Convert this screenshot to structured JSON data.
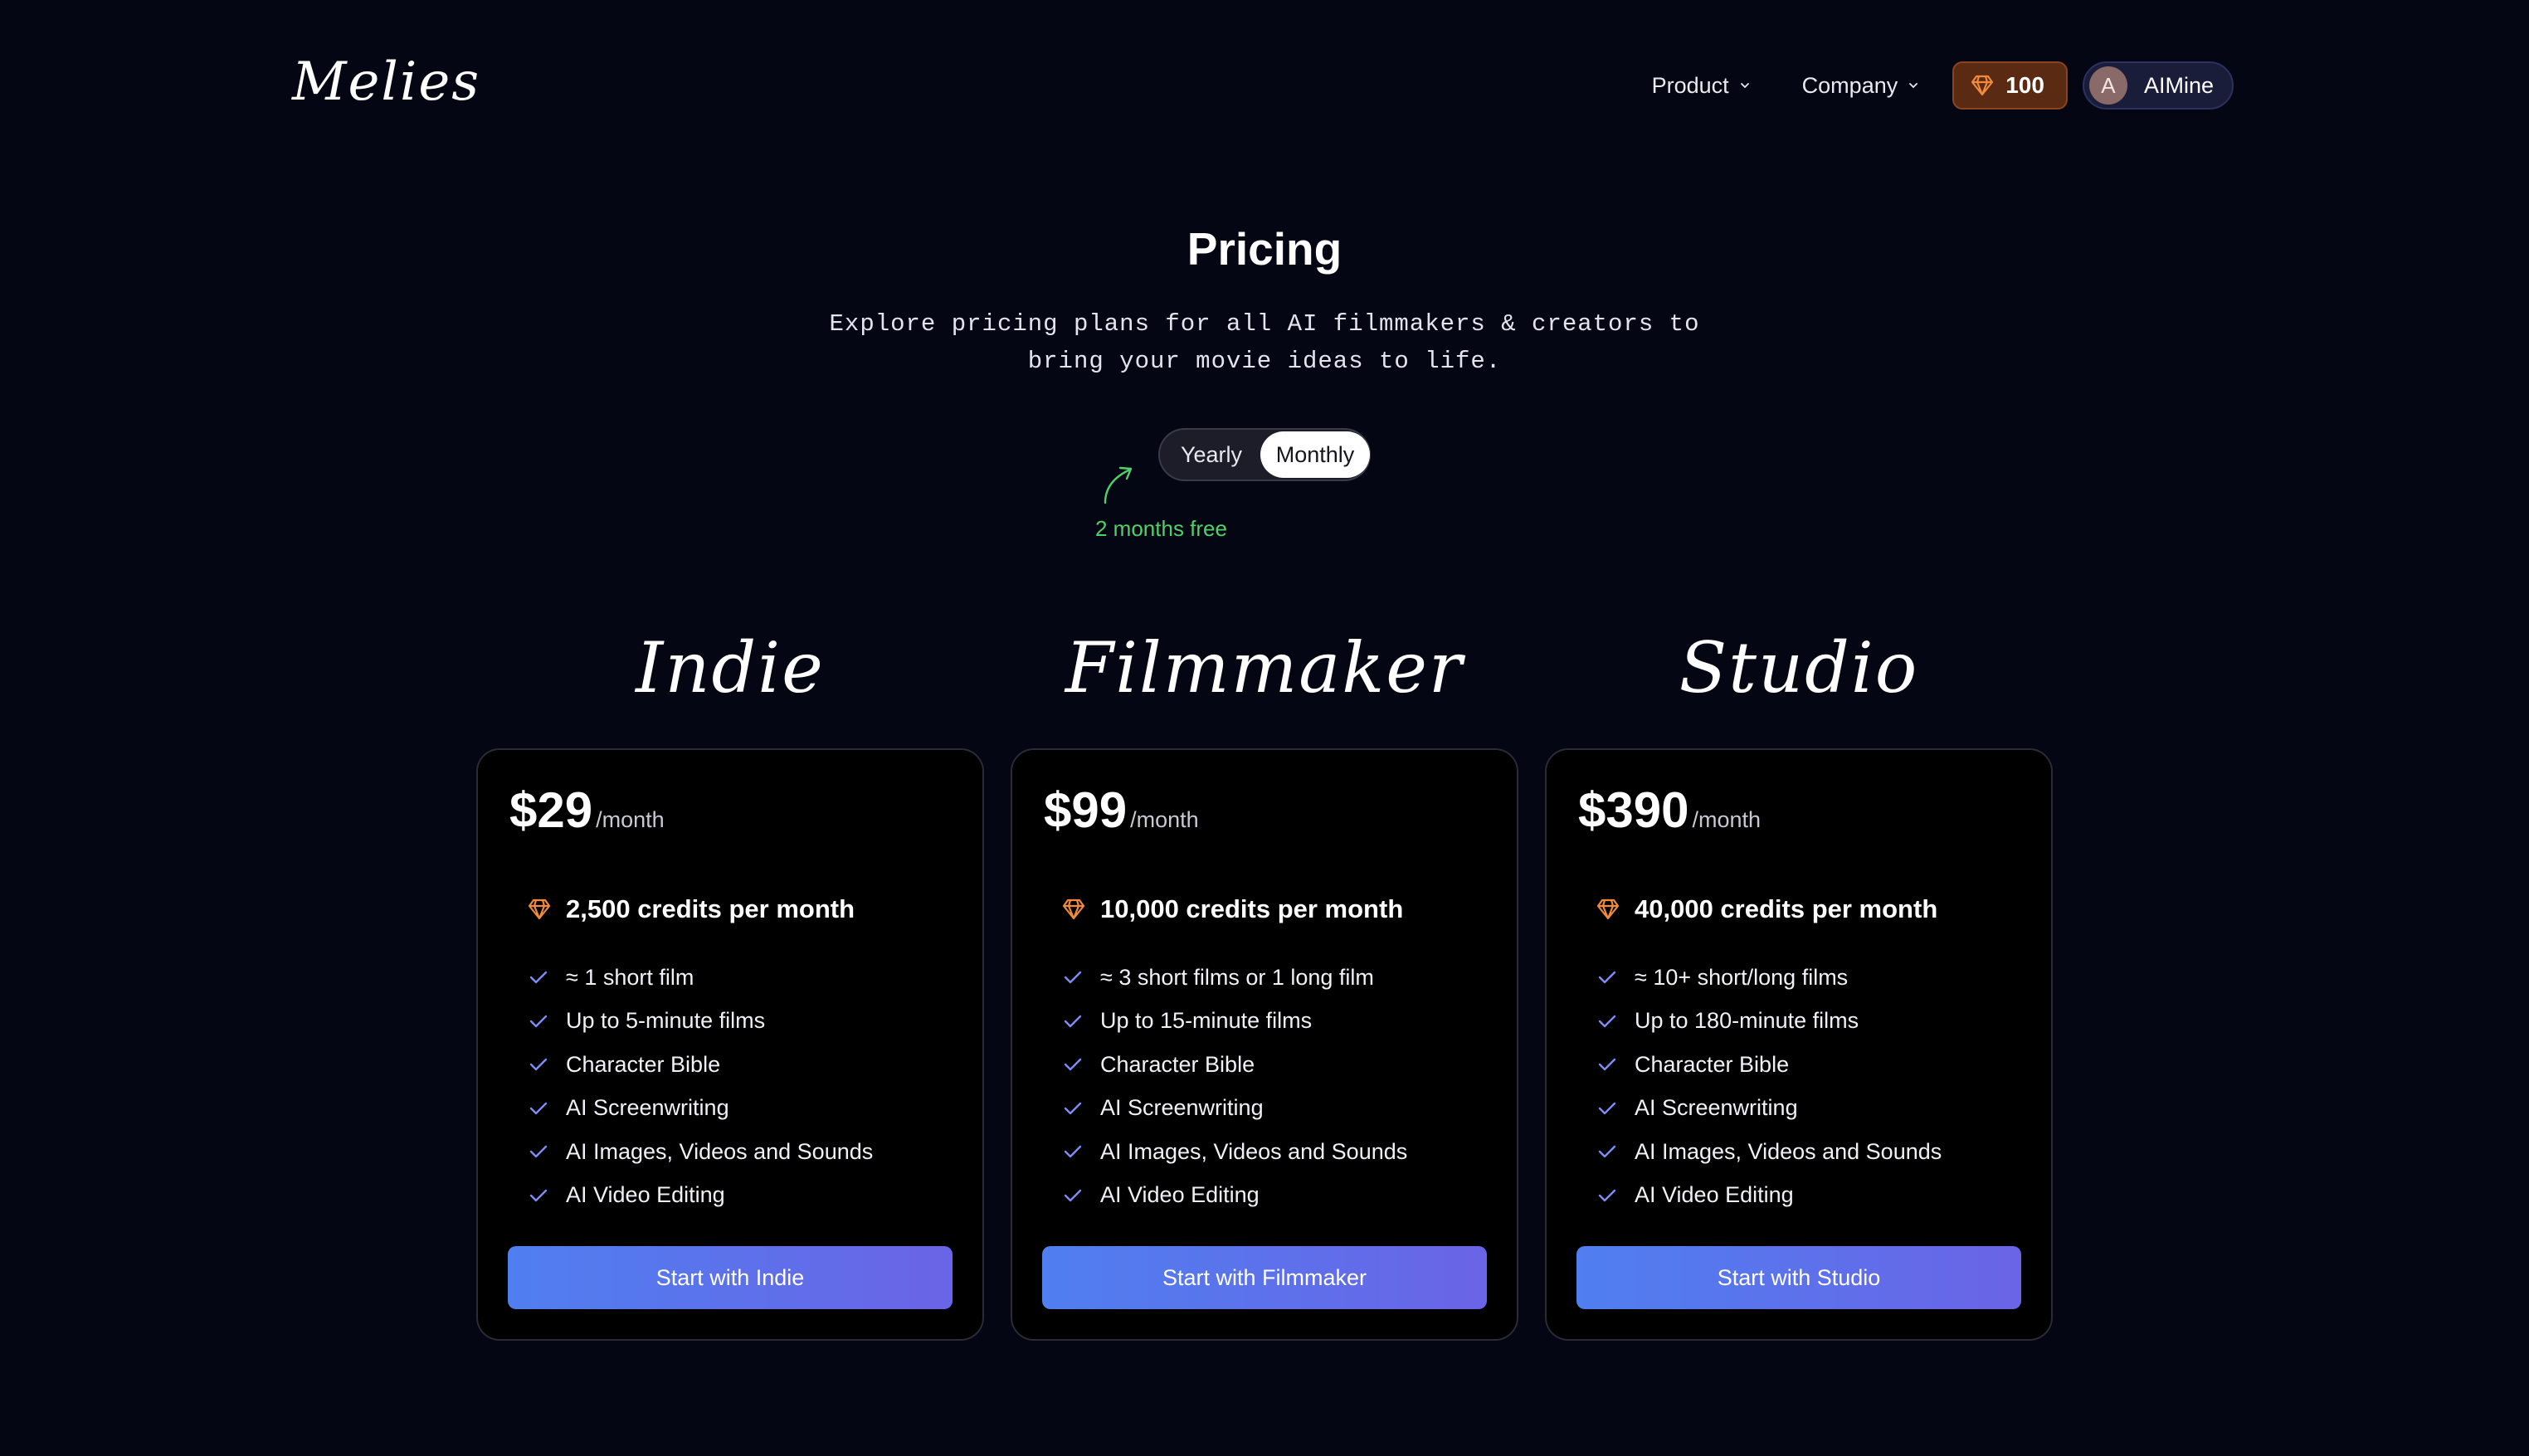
{
  "header": {
    "logo": "Melies",
    "nav": [
      {
        "label": "Product"
      },
      {
        "label": "Company"
      }
    ],
    "credits": "100",
    "user": {
      "initial": "A",
      "name": "AIMine"
    }
  },
  "hero": {
    "title": "Pricing",
    "subtitle_line1": "Explore pricing plans for all AI filmmakers & creators to",
    "subtitle_line2": "bring your movie ideas to life."
  },
  "billing": {
    "options": [
      "Yearly",
      "Monthly"
    ],
    "selected": "Monthly",
    "promo": "2 months free"
  },
  "plans": [
    {
      "name": "Indie",
      "price": "$29",
      "period": "/month",
      "credits": "2,500 credits per month",
      "features": [
        "≈ 1 short film",
        "Up to 5-minute films",
        "Character Bible",
        "AI Screenwriting",
        "AI Images, Videos and Sounds",
        "AI Video Editing"
      ],
      "cta": "Start with Indie"
    },
    {
      "name": "Filmmaker",
      "price": "$99",
      "period": "/month",
      "credits": "10,000 credits per month",
      "features": [
        "≈ 3 short films or 1 long film",
        "Up to 15-minute films",
        "Character Bible",
        "AI Screenwriting",
        "AI Images, Videos and Sounds",
        "AI Video Editing"
      ],
      "cta": "Start with Filmmaker"
    },
    {
      "name": "Studio",
      "price": "$390",
      "period": "/month",
      "credits": "40,000 credits per month",
      "features": [
        "≈ 10+ short/long films",
        "Up to 180-minute films",
        "Character Bible",
        "AI Screenwriting",
        "AI Images, Videos and Sounds",
        "AI Video Editing"
      ],
      "cta": "Start with Studio"
    }
  ],
  "colors": {
    "background": "#050613",
    "accent_start": "#4f7ff0",
    "accent_end": "#6a64e6",
    "credit_gem": "#f08a3c",
    "promo": "#4fd16a",
    "check": "#7f8cf5"
  },
  "icons": {
    "credits": "gem-icon",
    "feature": "check-icon",
    "dropdown": "chevron-down-icon",
    "promo": "curved-arrow-icon"
  }
}
